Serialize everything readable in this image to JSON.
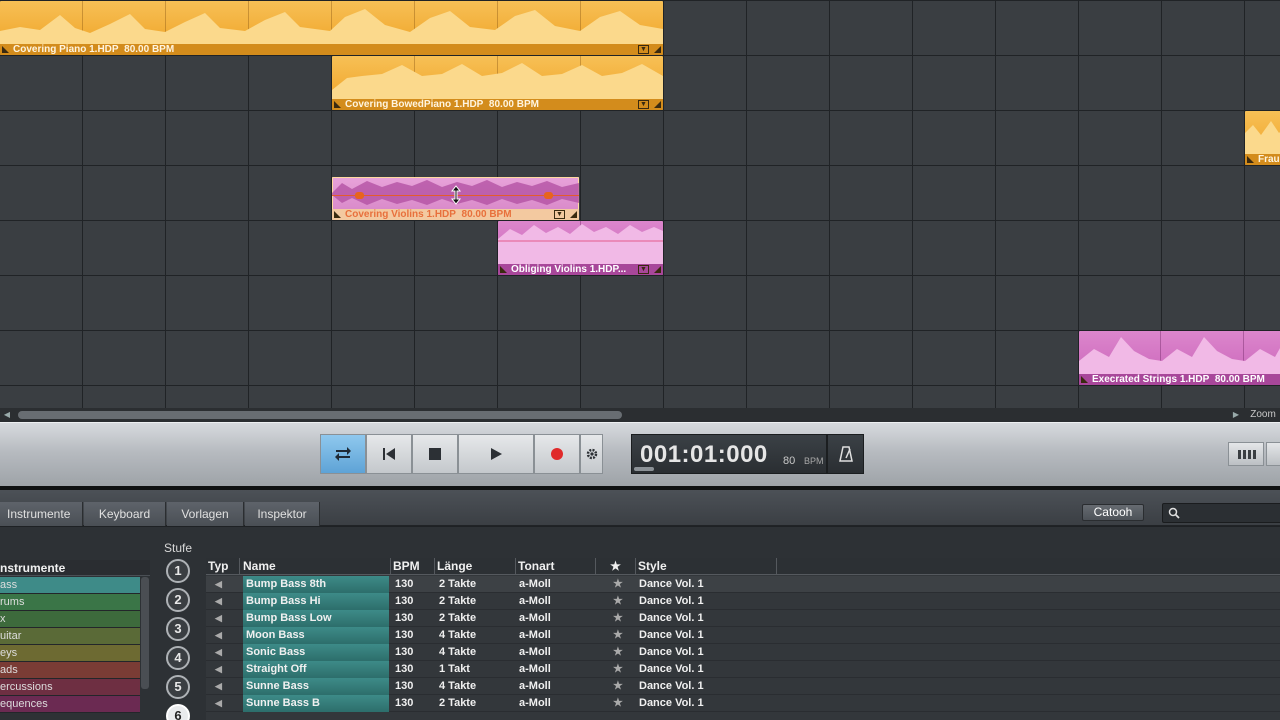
{
  "arranger": {
    "clips": [
      {
        "name": "Covering Piano 1.HDP",
        "bpm": "80.00 BPM",
        "color": "orange"
      },
      {
        "name": "Covering BowedPiano 1.HDP",
        "bpm": "80.00 BPM",
        "color": "orange"
      },
      {
        "name": "Frau",
        "bpm": "",
        "color": "orange"
      },
      {
        "name": "Covering Violins 1.HDP",
        "bpm": "80.00 BPM",
        "color": "pink"
      },
      {
        "name": "Obliging Violins 1.HDP...",
        "bpm": "",
        "color": "pink"
      },
      {
        "name": "Execrated Strings 1.HDP",
        "bpm": "80.00 BPM",
        "color": "pink"
      }
    ],
    "zoom_label": "Zoom"
  },
  "transport": {
    "time": "001:01:000",
    "bpm_value": "80",
    "bpm_label": "BPM",
    "icons": [
      "loop-icon",
      "skip-back-icon",
      "stop-icon",
      "play-icon",
      "record-icon",
      "gear-icon",
      "metronome-icon"
    ],
    "active_color": "#5ea3d6",
    "record_color": "#e02a2a"
  },
  "tabs": [
    {
      "label": "Instrumente"
    },
    {
      "label": "Keyboard"
    },
    {
      "label": "Vorlagen"
    },
    {
      "label": "Inspektor"
    }
  ],
  "catooh_label": "Catooh",
  "search": {
    "placeholder": ""
  },
  "instruments": {
    "header": "nstrumente",
    "items": [
      {
        "label": "ass",
        "color": "#3e8b88"
      },
      {
        "label": "rums",
        "color": "#3a7547"
      },
      {
        "label": "x",
        "color": "#3d6a3c"
      },
      {
        "label": "uitar",
        "color": "#5a6a37"
      },
      {
        "label": "eys",
        "color": "#6d6a32"
      },
      {
        "label": "ads",
        "color": "#7a3c35"
      },
      {
        "label": "ercussions",
        "color": "#6e2f42"
      },
      {
        "label": "equences",
        "color": "#6b2a52"
      }
    ]
  },
  "stufe": {
    "label": "Stufe",
    "levels": [
      "1",
      "2",
      "3",
      "4",
      "5",
      "6"
    ],
    "selected": "6"
  },
  "library": {
    "columns": {
      "typ": "Typ",
      "name": "Name",
      "bpm": "BPM",
      "laenge": "Länge",
      "tonart": "Tonart",
      "star": "★",
      "style": "Style"
    },
    "rows": [
      {
        "name": "Bump Bass 8th",
        "bpm": "130",
        "laenge": "2 Takte",
        "tonart": "a-Moll",
        "style": "Dance Vol. 1"
      },
      {
        "name": "Bump Bass Hi",
        "bpm": "130",
        "laenge": "2 Takte",
        "tonart": "a-Moll",
        "style": "Dance Vol. 1"
      },
      {
        "name": "Bump Bass Low",
        "bpm": "130",
        "laenge": "2 Takte",
        "tonart": "a-Moll",
        "style": "Dance Vol. 1"
      },
      {
        "name": "Moon Bass",
        "bpm": "130",
        "laenge": "4 Takte",
        "tonart": "a-Moll",
        "style": "Dance Vol. 1"
      },
      {
        "name": "Sonic Bass",
        "bpm": "130",
        "laenge": "4 Takte",
        "tonart": "a-Moll",
        "style": "Dance Vol. 1"
      },
      {
        "name": "Straight Off",
        "bpm": "130",
        "laenge": "1 Takt",
        "tonart": "a-Moll",
        "style": "Dance Vol. 1"
      },
      {
        "name": "Sunne Bass",
        "bpm": "130",
        "laenge": "4 Takte",
        "tonart": "a-Moll",
        "style": "Dance Vol. 1"
      },
      {
        "name": "Sunne Bass B",
        "bpm": "130",
        "laenge": "2 Takte",
        "tonart": "a-Moll",
        "style": "Dance Vol. 1"
      }
    ]
  }
}
